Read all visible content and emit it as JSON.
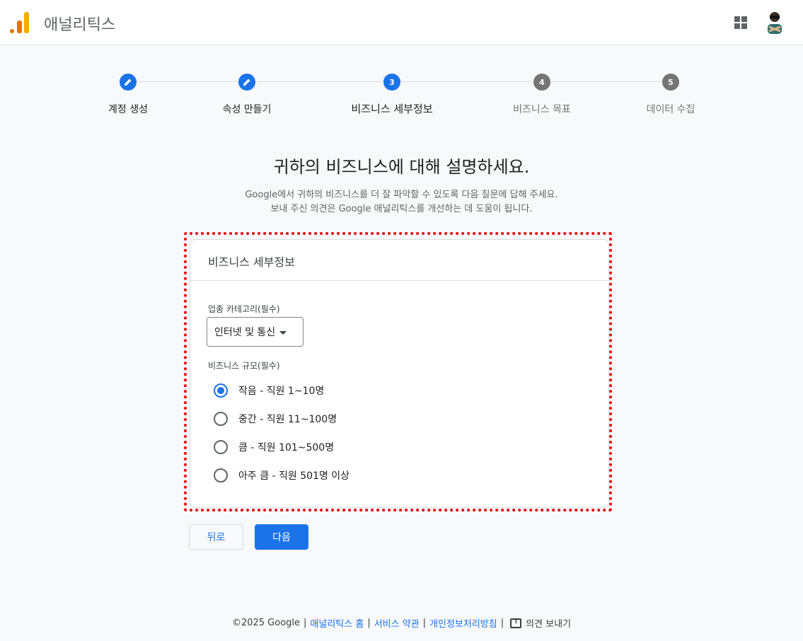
{
  "header": {
    "app_title": "애널리틱스",
    "icons": [
      "analytics-logo",
      "apps-grid-icon",
      "avatar"
    ]
  },
  "stepper": {
    "steps": [
      {
        "label": "계정 생성",
        "state": "done",
        "marker": "edit-icon"
      },
      {
        "label": "속성 만들기",
        "state": "done",
        "marker": "edit-icon"
      },
      {
        "label": "비즈니스 세부정보",
        "state": "active",
        "marker": "3"
      },
      {
        "label": "비즈니스 목표",
        "state": "pending",
        "marker": "4"
      },
      {
        "label": "데이터 수집",
        "state": "pending",
        "marker": "5"
      }
    ]
  },
  "intro": {
    "heading": "귀하의 비즈니스에 대해 설명하세요.",
    "desc_line1": "Google에서 귀하의 비즈니스를 더 잘 파악할 수 있도록 다음 질문에 답해 주세요.",
    "desc_line2": "보내 주신 의견은 Google 애널리틱스를 개선하는 데 도움이 됩니다."
  },
  "card": {
    "title": "비즈니스 세부정보",
    "category_label": "업종 카테고리(필수)",
    "category_value": "인터넷 및 통신",
    "size_label": "비즈니스 규모(필수)",
    "size_options": [
      {
        "label": "작음 - 직원 1~10명",
        "checked": true
      },
      {
        "label": "중간 - 직원 11~100명",
        "checked": false
      },
      {
        "label": "큼 - 직원 101~500명",
        "checked": false
      },
      {
        "label": "아주 큼 - 직원 501명 이상",
        "checked": false
      }
    ],
    "highlight_color": "#e8000b"
  },
  "buttons": {
    "back": "뒤로",
    "next": "다음"
  },
  "footer": {
    "copyright": "©2025 Google",
    "link_home": "애널리틱스 홈",
    "link_terms": "서비스 약관",
    "link_privacy": "개인정보처리방침",
    "feedback": "의견 보내기"
  },
  "colors": {
    "accent": "#1a73e8",
    "pending_step": "#757575",
    "background": "#f8f9fa"
  }
}
